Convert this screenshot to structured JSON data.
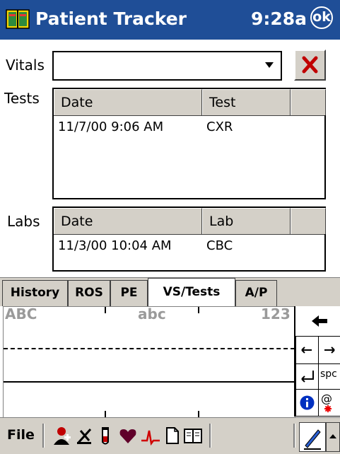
{
  "titlebar": {
    "title": "Patient Tracker",
    "time": "9:28a",
    "ok_label": "ok"
  },
  "vitals": {
    "label": "Vitals",
    "selected_value": ""
  },
  "tests": {
    "label": "Tests",
    "columns": [
      "Date",
      "Test"
    ],
    "rows": [
      {
        "date": "11/7/00 9:06 AM",
        "test": "CXR"
      }
    ]
  },
  "labs": {
    "label": "Labs",
    "columns": [
      "Date",
      "Lab"
    ],
    "rows": [
      {
        "date": "11/3/00 10:04 AM",
        "lab": "CBC"
      }
    ]
  },
  "tabs": [
    "History",
    "ROS",
    "PE",
    "VS/Tests",
    "A/P"
  ],
  "active_tab": "VS/Tests",
  "input_panel": {
    "left_hint": "ABC",
    "middle_hint": "abc",
    "right_hint": "123"
  },
  "side_keys": {
    "space": "spc",
    "symbols": "@"
  },
  "command_bar": {
    "file": "File"
  },
  "colors": {
    "titlebar": "#1f4e97",
    "chrome": "#d4d0c8",
    "delete_x": "#c00000"
  }
}
